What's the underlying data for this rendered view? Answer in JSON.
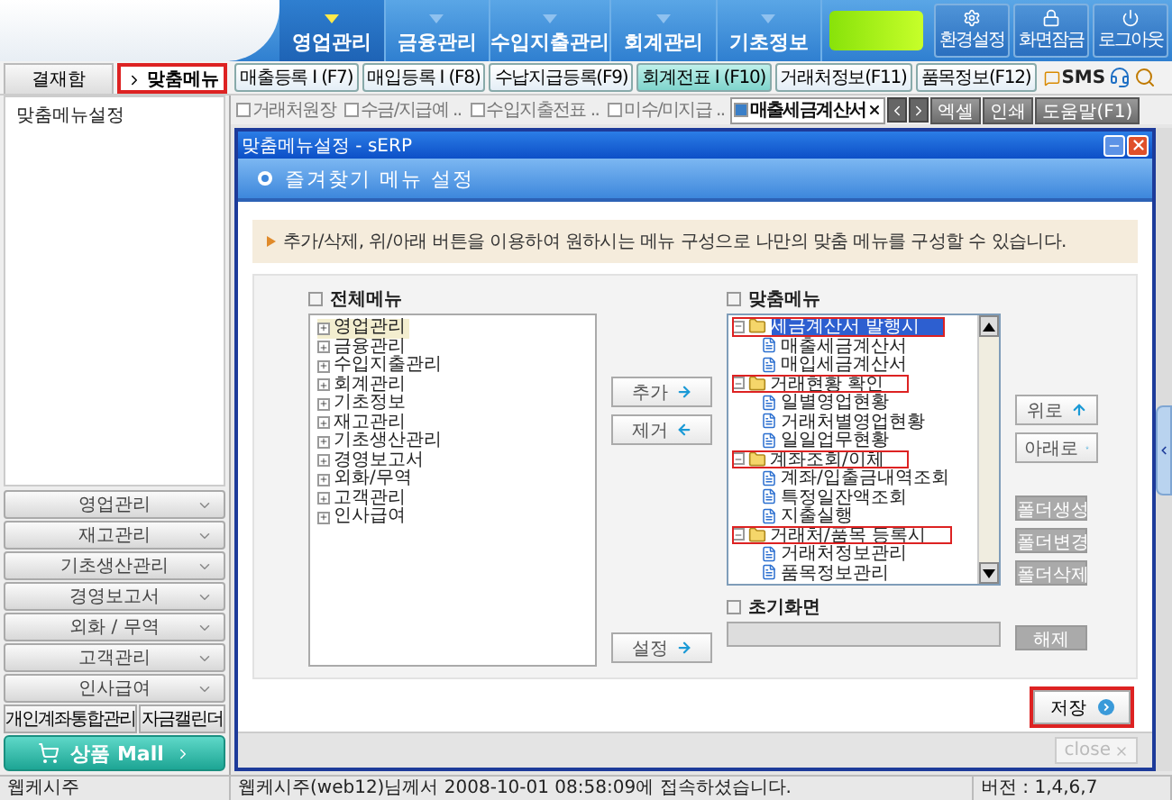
{
  "header": {
    "tabs": [
      {
        "label": "영업관리",
        "selected": true
      },
      {
        "label": "금융관리",
        "selected": false
      },
      {
        "label": "수입지출관리",
        "selected": false
      },
      {
        "label": "회계관리",
        "selected": false
      },
      {
        "label": "기초정보",
        "selected": false
      }
    ],
    "utility_buttons": [
      {
        "kind": "settings",
        "label": "환경설정"
      },
      {
        "kind": "lock",
        "label": "화면잠금"
      },
      {
        "kind": "logout",
        "label": "로그아웃"
      }
    ]
  },
  "side_tabs": [
    {
      "label": "결재함",
      "selected": false,
      "highlighted": false
    },
    {
      "label": "맞춤메뉴",
      "selected": true,
      "highlighted": true
    }
  ],
  "quick_buttons": [
    {
      "label": "매출등록 I (F7)",
      "selected": false
    },
    {
      "label": "매입등록 I (F8)",
      "selected": false
    },
    {
      "label": "수납지급등록(F9)",
      "selected": false
    },
    {
      "label": "회계전표 I (F10)",
      "selected": true
    },
    {
      "label": "거래처정보(F11)",
      "selected": false
    },
    {
      "label": "품목정보(F12)",
      "selected": false
    }
  ],
  "sms_label": "SMS",
  "window_tabs": [
    {
      "label": "거래처원장",
      "selected": false
    },
    {
      "label": "수금/지급예 ..",
      "selected": false
    },
    {
      "label": "수입지출전표 ..",
      "selected": false
    },
    {
      "label": "미수/미지급 ..",
      "selected": false
    },
    {
      "label": "매출세금계산서",
      "selected": true
    }
  ],
  "tool_buttons": [
    "엑셀",
    "인쇄",
    "도움말(F1)"
  ],
  "sidebar": {
    "tree": [
      "맞춤메뉴설정"
    ],
    "accordion": [
      "영업관리",
      "재고관리",
      "기초생산관리",
      "경영보고서",
      "외화 / 무역",
      "고객관리",
      "인사급여"
    ],
    "bottom_links": [
      "개인계좌통합관리",
      "자금캘린더"
    ],
    "mall_button": "상품 Mall"
  },
  "dialog": {
    "title": "맞춤메뉴설정 - sERP",
    "heading": "즐겨찾기 메뉴 설정",
    "notice": "추가/삭제, 위/아래 버튼을 이용하여 원하시는 메뉴 구성으로 나만의 맞춤 메뉴를 구성할 수 있습니다.",
    "all_menu": {
      "label": "전체메뉴",
      "items": [
        {
          "label": "영업관리",
          "selected": true
        },
        {
          "label": "금융관리",
          "selected": false
        },
        {
          "label": "수입지출관리",
          "selected": false
        },
        {
          "label": "회계관리",
          "selected": false
        },
        {
          "label": "기초정보",
          "selected": false
        },
        {
          "label": "재고관리",
          "selected": false
        },
        {
          "label": "기초생산관리",
          "selected": false
        },
        {
          "label": "경영보고서",
          "selected": false
        },
        {
          "label": "외화/무역",
          "selected": false
        },
        {
          "label": "고객관리",
          "selected": false
        },
        {
          "label": "인사급여",
          "selected": false
        }
      ]
    },
    "middle_buttons": [
      {
        "label": "추가",
        "kind": "right"
      },
      {
        "label": "제거",
        "kind": "left"
      }
    ],
    "set_button": "설정",
    "custom_menu": {
      "label": "맞춤메뉴",
      "items": [
        {
          "label": "세금계산서 발행시",
          "selected": true,
          "highlighted": true,
          "expanded": true,
          "children": [
            {
              "label": "매출세금계산서"
            },
            {
              "label": "매입세금계산서"
            }
          ]
        },
        {
          "label": "거래현황 확인",
          "selected": false,
          "highlighted": true,
          "expanded": true,
          "children": [
            {
              "label": "일별영업현황"
            },
            {
              "label": "거래처별영업현황"
            },
            {
              "label": "일일업무현황"
            }
          ]
        },
        {
          "label": "계좌조회/이체",
          "selected": false,
          "highlighted": true,
          "expanded": true,
          "children": [
            {
              "label": "계좌/입출금내역조회"
            },
            {
              "label": "특정일잔액조회"
            },
            {
              "label": "지출실행"
            }
          ]
        },
        {
          "label": "거래처/품목 등록시",
          "selected": false,
          "highlighted": true,
          "expanded": true,
          "children": [
            {
              "label": "거래처정보관리"
            },
            {
              "label": "품목정보관리"
            }
          ]
        }
      ]
    },
    "order_buttons": [
      {
        "label": "위로",
        "kind": "up"
      },
      {
        "label": "아래로",
        "kind": "down"
      }
    ],
    "folder_buttons": [
      {
        "label": "폴더생성",
        "disabled": true
      },
      {
        "label": "폴더변경",
        "disabled": true
      },
      {
        "label": "폴더삭제",
        "disabled": true
      }
    ],
    "start_page": {
      "label": "초기화면"
    },
    "clear_button": {
      "label": "해제",
      "disabled": true
    },
    "save_button": {
      "label": "저장",
      "highlighted": true
    },
    "close_button": {
      "label": "close",
      "disabled": true
    }
  },
  "status_bar": {
    "user": "웹케시주",
    "message": "웹케시주(web12)님께서 2008-10-01 08:58:09에 접속하셨습니다.",
    "version": "버전 : 1,4,6,7"
  }
}
